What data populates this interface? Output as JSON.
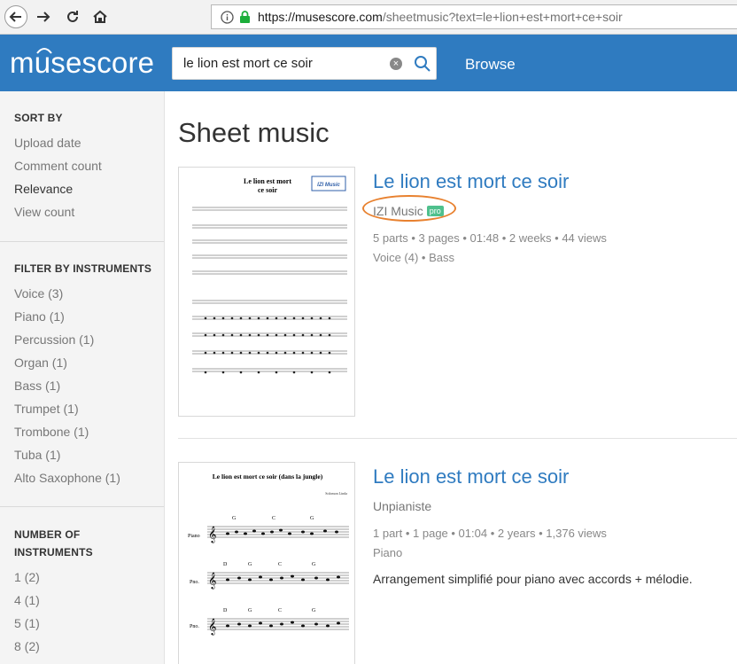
{
  "browser": {
    "url_host": "https://musescore.com",
    "url_rest": "/sheetmusic?text=le+lion+est+mort+ce+soir"
  },
  "header": {
    "logo_text": "musescore",
    "search_value": "le lion est mort ce soir",
    "browse_label": "Browse",
    "brand_color": "#2f7bc0"
  },
  "sidebar": {
    "sort_title": "SORT BY",
    "sort_items": [
      "Upload date",
      "Comment count",
      "Relevance",
      "View count"
    ],
    "active_sort": "Relevance",
    "filter_title": "FILTER BY INSTRUMENTS",
    "filter_items": [
      "Voice (3)",
      "Piano (1)",
      "Percussion (1)",
      "Organ (1)",
      "Bass (1)",
      "Trumpet (1)",
      "Trombone (1)",
      "Tuba (1)",
      "Alto Saxophone (1)"
    ],
    "number_title_line1": "NUMBER OF",
    "number_title_line2": "INSTRUMENTS",
    "number_items": [
      "1 (2)",
      "4 (1)",
      "5 (1)",
      "8 (2)"
    ]
  },
  "main": {
    "page_title": "Sheet music",
    "results": [
      {
        "title": "Le lion est mort ce soir",
        "author": "IZI Music",
        "badge": "pro",
        "meta": "5 parts • 3 pages • 01:48 • 2 weeks • 44 views",
        "instruments": "Voice (4) • Bass",
        "thumb_title_line1": "Le lion est mort",
        "thumb_title_line2": "ce soir",
        "thumb_logo": "IZI Music"
      },
      {
        "title": "Le lion est mort ce soir",
        "author": "Unpianiste",
        "meta": "1 part • 1 page • 01:04 • 2 years • 1,376 views",
        "instruments": "Piano",
        "description": "Arrangement simplifié pour piano avec accords + mélodie.",
        "thumb_title": "Le lion est mort ce soir (dans la jungle)",
        "thumb_composer": "Solomon Linda",
        "thumb_staff_labels": [
          "Piano",
          "Pno.",
          "Pno."
        ],
        "thumb_chords": [
          [
            "G",
            "C",
            "G"
          ],
          [
            "D",
            "G",
            "C",
            "G"
          ],
          [
            "D",
            "G",
            "C",
            "G"
          ]
        ]
      }
    ]
  }
}
